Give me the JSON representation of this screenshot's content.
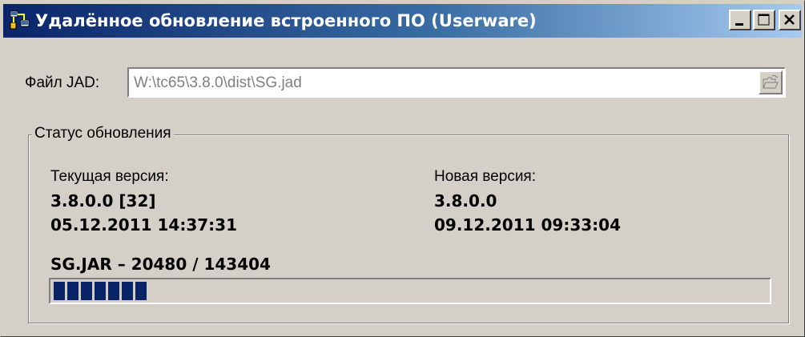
{
  "window": {
    "title": "Удалённое обновление встроенного ПО (Userware)",
    "icon": "app-network-icon",
    "title_gradient": [
      "#0a246a",
      "#a6caf0"
    ]
  },
  "jad": {
    "label": "Файл JAD:",
    "value": "W:\\tc65\\3.8.0\\dist\\SG.jad",
    "browse_icon": "open-folder-icon"
  },
  "status": {
    "legend": "Статус обновления",
    "current": {
      "label": "Текущая версия:",
      "version": "3.8.0.0 [32]",
      "date": "05.12.2011 14:37:31"
    },
    "new": {
      "label": "Новая версия:",
      "version": "3.8.0.0",
      "date": "09.12.2011 09:33:04"
    },
    "transfer": "SG.JAR – 20480 / 143404",
    "progress": {
      "value": 20480,
      "max": 143404,
      "color": "#0a246a"
    }
  }
}
